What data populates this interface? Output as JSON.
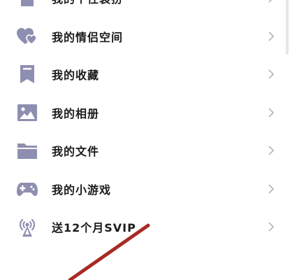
{
  "colors": {
    "icon": "#8e8fb0",
    "text": "#1b1b1b",
    "chevron": "#b8b8bf",
    "overlay_stroke": "#a82a25"
  },
  "menu": {
    "items": [
      {
        "label": "我的个性装扮",
        "icon": "tshirt-icon"
      },
      {
        "label": "我的情侣空间",
        "icon": "hearts-icon"
      },
      {
        "label": "我的收藏",
        "icon": "bookmark-icon"
      },
      {
        "label": "我的相册",
        "icon": "photo-icon"
      },
      {
        "label": "我的文件",
        "icon": "folder-icon"
      },
      {
        "label": "我的小游戏",
        "icon": "gamepad-icon"
      },
      {
        "label": "送12个月SVIP",
        "icon": "broadcast-icon"
      }
    ]
  }
}
